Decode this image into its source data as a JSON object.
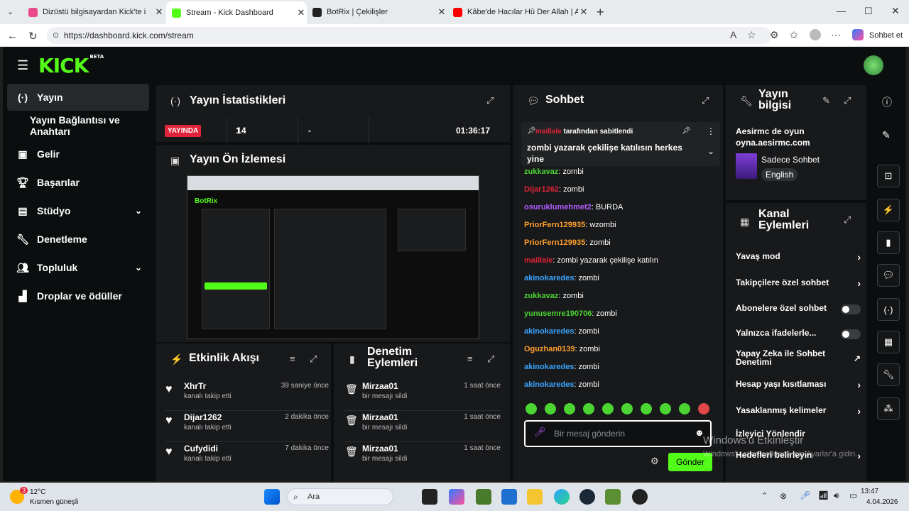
{
  "browser": {
    "tabs": [
      {
        "label": "Dizüstü bilgisayardan Kick'te i",
        "favicon_color": "#e94b8a"
      },
      {
        "label": "Stream - Kick Dashboard",
        "favicon_color": "#53fc18"
      },
      {
        "label": "BotRix | Çekilişler",
        "favicon_color": "#222222"
      },
      {
        "label": "Kâbe'de Hacılar Hû Der Allah | Abc",
        "favicon_color": "#ff0000"
      }
    ],
    "url": "https://dashboard.kick.com/stream",
    "copilot_label": "Sohbet et"
  },
  "app": {
    "brand": "KICK",
    "brand_badge": "BETA",
    "accent": "#53fc18",
    "sidebar": [
      {
        "label": "Yayın",
        "icon": "broadcast-icon"
      },
      {
        "label": "Yayın Bağlantısı ve Anahtarı",
        "icon": ""
      },
      {
        "label": "Gelir",
        "icon": "revenue-icon"
      },
      {
        "label": "Başarılar",
        "icon": "trophy-icon"
      },
      {
        "label": "Stüdyo",
        "icon": "studio-icon"
      },
      {
        "label": "Denetleme",
        "icon": "wrench-icon"
      },
      {
        "label": "Topluluk",
        "icon": "community-icon"
      },
      {
        "label": "Droplar ve ödüller",
        "icon": "drops-icon"
      }
    ],
    "stats": {
      "title": "Yayın İstatistikleri",
      "live_badge": "YAYINDA",
      "viewers": "14",
      "followers": "1",
      "subs": "-",
      "duration": "01:36:17"
    },
    "preview": {
      "title": "Yayın Ön İzlemesi",
      "inner_brand": "BotRix"
    },
    "activity": {
      "title": "Etkinlik Akışı",
      "items": [
        {
          "name": "XhrTr",
          "action": "kanalı takip etti",
          "time": "39 saniye önce"
        },
        {
          "name": "Dijar1262",
          "action": "kanalı takip etti",
          "time": "2 dakika önce"
        },
        {
          "name": "Cufydidi",
          "action": "kanalı takip etti",
          "time": "7 dakika önce"
        }
      ]
    },
    "moderation": {
      "title": "Denetim Eylemleri",
      "items": [
        {
          "name": "Mirzaa01",
          "action": "bir mesajı sildi",
          "time": "1 saat önce"
        },
        {
          "name": "Mirzaa01",
          "action": "bir mesajı sildi",
          "time": "1 saat önce"
        },
        {
          "name": "Mirzaa01",
          "action": "bir mesajı sildi",
          "time": "1 saat önce"
        }
      ]
    },
    "chat": {
      "title": "Sohbet",
      "pinned_by": "maillale",
      "pinned_suffix": "tarafından sabitlendi",
      "pinned_text": "zombi yazarak çekilişe katılısın herkes yine",
      "messages": [
        {
          "user": "zukkavaz",
          "color": "#4bd432",
          "text": "zombi"
        },
        {
          "user": "Dijar1262",
          "color": "#e0233b",
          "text": "zombi"
        },
        {
          "user": "osuruklumehmet2",
          "color": "#b25cff",
          "text": "BURDA"
        },
        {
          "user": "PriorFern129935",
          "color": "#ff9f2e",
          "text": "wzombi"
        },
        {
          "user": "PriorFern129935",
          "color": "#ff9f2e",
          "text": "zombi"
        },
        {
          "user": "maillale",
          "color": "#e0233b",
          "text": "zombi yazarak çekilişe katılın"
        },
        {
          "user": "akinokaredes",
          "color": "#3aa5ff",
          "text": "zombi"
        },
        {
          "user": "zukkavaz",
          "color": "#4bd432",
          "text": "zombi"
        },
        {
          "user": "yunusemre190706",
          "color": "#4bd432",
          "text": "zombi"
        },
        {
          "user": "akinokaredes",
          "color": "#3aa5ff",
          "text": "zombi"
        },
        {
          "user": "Oguzhan0139",
          "color": "#ff9f2e",
          "text": "zombi"
        },
        {
          "user": "akinokaredes",
          "color": "#3aa5ff",
          "text": "zombi"
        },
        {
          "user": "akinokaredes",
          "color": "#3aa5ff",
          "text": "zombi"
        }
      ],
      "placeholder": "Bir mesaj gönderin",
      "send_label": "Gönder"
    },
    "stream_info": {
      "title": "Yayın bilgisi",
      "stream_title": "Aesirmc de oyun oyna.aesirmc.com",
      "category": "Sadece Sohbet",
      "language": "English"
    },
    "channel_actions": {
      "title": "Kanal Eylemleri",
      "items": [
        {
          "label": "Yavaş mod",
          "control": "chevron"
        },
        {
          "label": "Takipçilere özel sohbet",
          "control": "chevron"
        },
        {
          "label": "Abonelere özel sohbet",
          "control": "toggle"
        },
        {
          "label": "Yalnızca ifadelerle...",
          "control": "toggle"
        },
        {
          "label": "Yapay Zeka ile Sohbet Denetimi",
          "control": "external"
        },
        {
          "label": "Hesap yaşı kısıtlaması",
          "control": "chevron"
        },
        {
          "label": "Yasaklanmış kelimeler",
          "control": "chevron"
        },
        {
          "label": "İzleyici Yönlendir",
          "control": ""
        },
        {
          "label": "Hedefleri belirleyin",
          "control": "chevron"
        }
      ]
    }
  },
  "windows": {
    "watermark_title": "Windows'u Etkinleştir",
    "watermark_sub": "Windows'u etkinleştirmek için Ayarlar'a gidin.",
    "weather_temp": "12°C",
    "weather_desc": "Kısmen güneşli",
    "weather_badge": "3",
    "search": "Ara",
    "time": "13:47",
    "date": "4.04.2026"
  }
}
